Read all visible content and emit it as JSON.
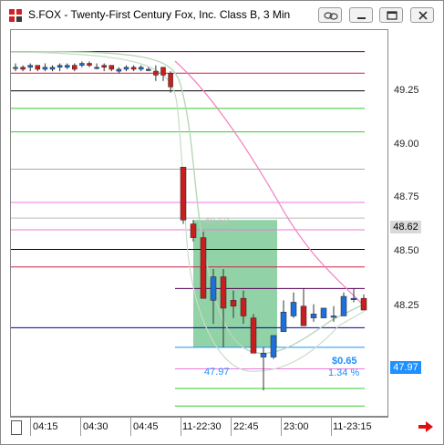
{
  "window": {
    "title": "S.FOX - Twenty-First Century Fox, Inc. Class B, 3 Min",
    "icons": [
      "app-chart-icon",
      "link-icon",
      "minimize-icon",
      "restore-icon",
      "close-icon"
    ]
  },
  "colors": {
    "up": "#1f6fd8",
    "down": "#c81e1e",
    "highlight": "#6cc48a",
    "last_price_tag": "#1e90ff",
    "current_tag": "#d9d9d9",
    "pink_line": "#f080c0",
    "envelope": "#c8dcc8"
  },
  "chart_data": {
    "type": "candlestick",
    "title": "S.FOX - Twenty-First Century Fox, Inc. Class B, 3 Min",
    "xlabel": "",
    "ylabel": "",
    "x_tick_labels": [
      "04:15",
      "04:30",
      "04:45",
      "11-22:30",
      "22:45",
      "23:00",
      "11-23:15"
    ],
    "y_ticks": [
      49.25,
      49.0,
      48.75,
      48.5,
      48.25
    ],
    "ylim": [
      47.62,
      49.59
    ],
    "grid": false,
    "price_tags": {
      "current": "48.62",
      "last": "47.97"
    },
    "annotations": {
      "range_high_label": "48.62",
      "range_low_label": "47.97",
      "change_abs": "$0.65",
      "change_pct": "1.34 %"
    },
    "session_one": [
      {
        "o": 49.4,
        "h": 49.42,
        "l": 49.38,
        "c": 49.4
      },
      {
        "o": 49.4,
        "h": 49.41,
        "l": 49.38,
        "c": 49.39
      },
      {
        "o": 49.4,
        "h": 49.42,
        "l": 49.38,
        "c": 49.41
      },
      {
        "o": 49.41,
        "h": 49.41,
        "l": 49.38,
        "c": 49.39
      },
      {
        "o": 49.39,
        "h": 49.42,
        "l": 49.38,
        "c": 49.4
      },
      {
        "o": 49.39,
        "h": 49.41,
        "l": 49.38,
        "c": 49.4
      },
      {
        "o": 49.4,
        "h": 49.42,
        "l": 49.38,
        "c": 49.41
      },
      {
        "o": 49.4,
        "h": 49.42,
        "l": 49.39,
        "c": 49.41
      },
      {
        "o": 49.41,
        "h": 49.42,
        "l": 49.38,
        "c": 49.39
      },
      {
        "o": 49.41,
        "h": 49.43,
        "l": 49.4,
        "c": 49.42
      },
      {
        "o": 49.42,
        "h": 49.43,
        "l": 49.4,
        "c": 49.41
      },
      {
        "o": 49.4,
        "h": 49.42,
        "l": 49.39,
        "c": 49.4
      },
      {
        "o": 49.41,
        "h": 49.42,
        "l": 49.38,
        "c": 49.4
      },
      {
        "o": 49.41,
        "h": 49.41,
        "l": 49.38,
        "c": 49.39
      },
      {
        "o": 49.38,
        "h": 49.4,
        "l": 49.37,
        "c": 49.39
      },
      {
        "o": 49.39,
        "h": 49.41,
        "l": 49.38,
        "c": 49.4
      },
      {
        "o": 49.4,
        "h": 49.41,
        "l": 49.38,
        "c": 49.39
      },
      {
        "o": 49.39,
        "h": 49.41,
        "l": 49.38,
        "c": 49.4
      },
      {
        "o": 49.39,
        "h": 49.4,
        "l": 49.38,
        "c": 49.39
      },
      {
        "o": 49.38,
        "h": 49.41,
        "l": 49.33,
        "c": 49.36
      },
      {
        "o": 49.4,
        "h": 49.4,
        "l": 49.33,
        "c": 49.36
      },
      {
        "o": 49.37,
        "h": 49.38,
        "l": 49.27,
        "c": 49.3
      }
    ],
    "session_two": [
      {
        "o": 48.89,
        "h": 48.89,
        "l": 48.6,
        "c": 48.62
      },
      {
        "o": 48.6,
        "h": 48.62,
        "l": 48.51,
        "c": 48.53
      },
      {
        "o": 48.53,
        "h": 48.56,
        "l": 48.22,
        "c": 48.22
      },
      {
        "o": 48.21,
        "h": 48.37,
        "l": 48.09,
        "c": 48.33
      },
      {
        "o": 48.33,
        "h": 48.37,
        "l": 47.97,
        "c": 48.17
      },
      {
        "o": 48.21,
        "h": 48.26,
        "l": 48.12,
        "c": 48.18
      },
      {
        "o": 48.22,
        "h": 48.26,
        "l": 48.09,
        "c": 48.13
      },
      {
        "o": 48.12,
        "h": 48.14,
        "l": 47.94,
        "c": 47.94
      },
      {
        "o": 47.92,
        "h": 47.97,
        "l": 47.75,
        "c": 47.94
      },
      {
        "o": 47.92,
        "h": 48.03,
        "l": 47.91,
        "c": 48.03
      },
      {
        "o": 48.05,
        "h": 48.21,
        "l": 48.05,
        "c": 48.15
      },
      {
        "o": 48.13,
        "h": 48.25,
        "l": 48.12,
        "c": 48.2
      },
      {
        "o": 48.18,
        "h": 48.27,
        "l": 48.08,
        "c": 48.08
      },
      {
        "o": 48.12,
        "h": 48.19,
        "l": 48.1,
        "c": 48.14
      },
      {
        "o": 48.12,
        "h": 48.17,
        "l": 48.12,
        "c": 48.17
      },
      {
        "o": 48.13,
        "h": 48.18,
        "l": 48.1,
        "c": 48.13
      },
      {
        "o": 48.13,
        "h": 48.25,
        "l": 48.13,
        "c": 48.23
      },
      {
        "o": 48.22,
        "h": 48.27,
        "l": 48.2,
        "c": 48.22
      },
      {
        "o": 48.22,
        "h": 48.24,
        "l": 48.16,
        "c": 48.16
      }
    ],
    "level_lines": [
      {
        "y": 49.48,
        "color": "#550055",
        "from": "early"
      },
      {
        "y": 49.37,
        "color": "#cc2244",
        "from": "early"
      },
      {
        "y": 49.28,
        "color": "#000000",
        "from": "early"
      },
      {
        "y": 49.19,
        "color": "#33cc33",
        "from": "early"
      },
      {
        "y": 49.07,
        "color": "#33cc33",
        "from": "early"
      },
      {
        "y": 48.88,
        "color": "#aaaaaa",
        "from": "early"
      },
      {
        "y": 48.71,
        "color": "#ee77dd",
        "from": "early"
      },
      {
        "y": 48.63,
        "color": "#bbbbbb",
        "from": "early"
      },
      {
        "y": 48.57,
        "color": "#ee77dd",
        "from": "early"
      },
      {
        "y": 48.47,
        "color": "#000000",
        "from": "early"
      },
      {
        "y": 48.38,
        "color": "#cc2244",
        "from": "early"
      },
      {
        "y": 48.27,
        "color": "#550055",
        "from": "late"
      },
      {
        "y": 48.07,
        "color": "#000099",
        "from": "early"
      },
      {
        "y": 47.97,
        "color": "#1e90ff",
        "from": "late"
      },
      {
        "y": 47.86,
        "color": "#ee77dd",
        "from": "late"
      },
      {
        "y": 47.76,
        "color": "#33cc33",
        "from": "late"
      },
      {
        "y": 47.67,
        "color": "#33cc33",
        "from": "late"
      }
    ],
    "highlight_range": {
      "low": 47.97,
      "high": 48.62
    }
  }
}
